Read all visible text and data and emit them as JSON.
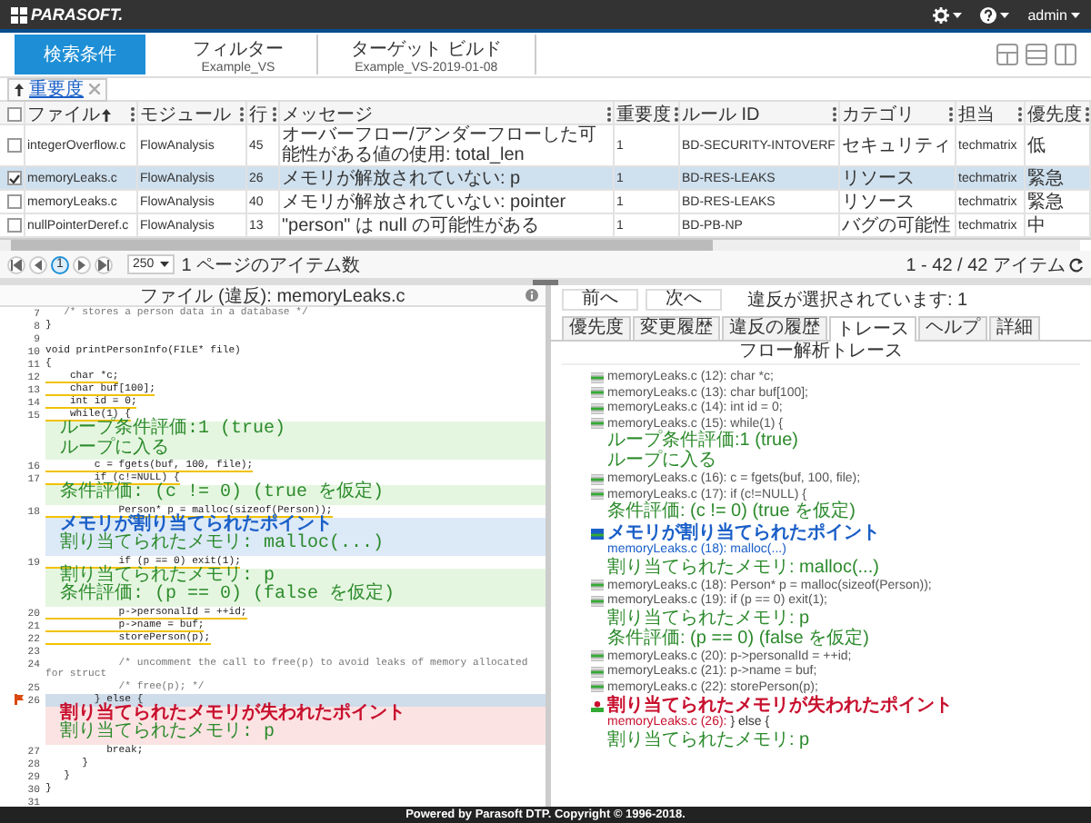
{
  "top_bar": {
    "logo": "PARASOFT.",
    "user": "admin"
  },
  "toolbar": {
    "items": [
      {
        "label": "検索条件",
        "selected": true
      },
      {
        "label": "フィルター",
        "value": "Example_VS",
        "selected": false
      },
      {
        "label": "ターゲット ビルド",
        "value": "Example_VS-2019-01-08",
        "selected": false
      }
    ]
  },
  "sort_chip": {
    "label": "重要度"
  },
  "table": {
    "select_all_checked": false,
    "columns": [
      {
        "label": "ファイル",
        "sorted": true
      },
      {
        "label": "モジュール",
        "sorted": false
      },
      {
        "label": "行",
        "sorted": false
      },
      {
        "label": "メッセージ",
        "sorted": false
      },
      {
        "label": "重要度",
        "sorted": false
      },
      {
        "label": "ルール ID",
        "sorted": false
      },
      {
        "label": "カテゴリ",
        "sorted": false
      },
      {
        "label": "担当",
        "sorted": false
      },
      {
        "label": "優先度",
        "sorted": false
      }
    ],
    "rows": [
      {
        "cells": [
          "integerOverflow.c",
          "FlowAnalysis",
          "45",
          "オーバーフロー/アンダーフローした可能性がある値の使用: total_len",
          "1",
          "BD-SECURITY-INTOVERF",
          "セキュリティ",
          "techmatrix",
          "低"
        ],
        "checked": false,
        "selected": false
      },
      {
        "cells": [
          "memoryLeaks.c",
          "FlowAnalysis",
          "26",
          "メモリが解放されていない: p",
          "1",
          "BD-RES-LEAKS",
          "リソース",
          "techmatrix",
          "緊急"
        ],
        "checked": true,
        "selected": true
      },
      {
        "cells": [
          "memoryLeaks.c",
          "FlowAnalysis",
          "40",
          "メモリが解放されていない: pointer",
          "1",
          "BD-RES-LEAKS",
          "リソース",
          "techmatrix",
          "緊急"
        ],
        "checked": false,
        "selected": false
      },
      {
        "cells": [
          "nullPointerDeref.c",
          "FlowAnalysis",
          "13",
          "\"person\" は null の可能性がある",
          "1",
          "BD-PB-NP",
          "バグの可能性",
          "techmatrix",
          "中"
        ],
        "checked": false,
        "selected": false
      }
    ]
  },
  "pagination": {
    "page": "1",
    "page_size": "250",
    "page_size_label": "1 ページのアイテム数",
    "range": "1 - 42 / 42 アイテム"
  },
  "source_panel": {
    "title": "ファイル (違反): memoryLeaks.c",
    "lines": [
      {
        "kind": "comment",
        "num": "7",
        "text": "   /* stores a person data in a database */",
        "traced": false,
        "selected": false
      },
      {
        "kind": "code",
        "num": "8",
        "text": "}",
        "traced": false,
        "selected": false
      },
      {
        "kind": "code",
        "num": "9",
        "traced": false,
        "selected": false
      },
      {
        "kind": "code",
        "num": "10",
        "text": "void printPersonInfo(FILE* file)",
        "traced": false,
        "selected": false
      },
      {
        "kind": "code",
        "num": "11",
        "text": "{",
        "traced": false,
        "selected": false
      },
      {
        "kind": "code",
        "num": "12",
        "text": "    char *c;",
        "traced": true,
        "selected": false
      },
      {
        "kind": "code",
        "num": "13",
        "text": "    char buf[100];",
        "traced": true,
        "selected": false
      },
      {
        "kind": "code",
        "num": "14",
        "text": "    int id = 0;",
        "traced": true,
        "selected": false
      },
      {
        "kind": "code",
        "num": "15",
        "text": "    while(1) {",
        "traced": true,
        "selected": false
      },
      {
        "kind": "branch",
        "lines": [
          {
            "kind": "value",
            "text": "ループ条件評価:1 (true)"
          },
          {
            "kind": "value",
            "text": "ループに入る"
          }
        ]
      },
      {
        "kind": "code",
        "num": "16",
        "text": "        c = fgets(buf, 100, file);",
        "traced": true,
        "selected": false
      },
      {
        "kind": "code",
        "num": "17",
        "text": "        if (c!=NULL) {",
        "traced": true,
        "selected": false
      },
      {
        "kind": "branch",
        "lines": [
          {
            "kind": "value",
            "text": "条件評価: (c != 0) (true を仮定)"
          }
        ]
      },
      {
        "kind": "code",
        "num": "18",
        "text": "            Person* p = malloc(sizeof(Person));",
        "traced": true,
        "selected": false
      },
      {
        "kind": "alloc",
        "lines": [
          {
            "kind": "event",
            "text": "メモリが割り当てられたポイント"
          },
          {
            "kind": "value",
            "text": "割り当てられたメモリ: malloc(...)"
          }
        ]
      },
      {
        "kind": "code",
        "num": "19",
        "text": "            if (p == 0) exit(1);",
        "traced": true,
        "selected": false
      },
      {
        "kind": "branch",
        "lines": [
          {
            "kind": "value",
            "text": "割り当てられたメモリ: p"
          },
          {
            "kind": "value",
            "text": "条件評価: (p == 0) (false を仮定)"
          }
        ]
      },
      {
        "kind": "code",
        "num": "20",
        "text": "            p->personalId = ++id;",
        "traced": true,
        "selected": false
      },
      {
        "kind": "code",
        "num": "21",
        "text": "            p->name = buf;",
        "traced": true,
        "selected": false
      },
      {
        "kind": "code",
        "num": "22",
        "text": "            storePerson(p);",
        "traced": true,
        "selected": false
      },
      {
        "kind": "code",
        "num": "23",
        "traced": false,
        "selected": false
      },
      {
        "kind": "comment",
        "num": "24",
        "text": "            /* uncomment the call to free(p) to avoid leaks of memory allocated for struct",
        "traced": false,
        "selected": false
      },
      {
        "kind": "comment",
        "num": "25",
        "text": "            /* free(p); */",
        "traced": false,
        "selected": false
      },
      {
        "kind": "code",
        "num": "26",
        "text": "        } else {",
        "traced": false,
        "selected": true
      },
      {
        "kind": "leak",
        "lines": [
          {
            "kind": "event",
            "text": "割り当てられたメモリが失われたポイント"
          },
          {
            "kind": "value",
            "text": "割り当てられたメモリ: p"
          }
        ]
      },
      {
        "kind": "code",
        "num": "27",
        "text": "          break;",
        "traced": false,
        "selected": false
      },
      {
        "kind": "code",
        "num": "28",
        "text": "      }",
        "traced": false,
        "selected": false
      },
      {
        "kind": "code",
        "num": "29",
        "text": "   }",
        "traced": false,
        "selected": false
      },
      {
        "kind": "code",
        "num": "30",
        "text": "}",
        "traced": false,
        "selected": false
      },
      {
        "kind": "code",
        "num": "31",
        "traced": false,
        "selected": false
      }
    ]
  },
  "violation_panel": {
    "buttons": [
      "前へ",
      "次へ"
    ],
    "status": "違反が選択されています: 1",
    "tabs": [
      {
        "label": "優先度",
        "selected": false
      },
      {
        "label": "変更履歴",
        "selected": false
      },
      {
        "label": "違反の履歴",
        "selected": false
      },
      {
        "label": "トレース",
        "selected": true
      },
      {
        "label": "ヘルプ",
        "selected": false
      },
      {
        "label": "詳細",
        "selected": false
      }
    ],
    "trace_title": "フロー解析トレース",
    "trace": [
      {
        "kind": "step",
        "text": "memoryLeaks.c (12): char *c;"
      },
      {
        "kind": "step",
        "text": "memoryLeaks.c (13): char buf[100];"
      },
      {
        "kind": "step",
        "text": "memoryLeaks.c (14): int id = 0;"
      },
      {
        "kind": "step",
        "text": "memoryLeaks.c (15): while(1) {",
        "details": [
          "ループ条件評価:1 (true)",
          "ループに入る"
        ]
      },
      {
        "kind": "step",
        "text": "memoryLeaks.c (16): c = fgets(buf, 100, file);"
      },
      {
        "kind": "step",
        "text": "memoryLeaks.c (17): if (c!=NULL) {",
        "details": [
          "条件評価: (c != 0) (true を仮定)"
        ]
      },
      {
        "kind": "alloc",
        "text": "メモリが割り当てられたポイント",
        "location": "memoryLeaks.c (18): malloc(...)",
        "details": [
          "割り当てられたメモリ: malloc(...)"
        ]
      },
      {
        "kind": "step",
        "text": "memoryLeaks.c (18): Person* p = malloc(sizeof(Person));"
      },
      {
        "kind": "step",
        "text": "memoryLeaks.c (19): if (p == 0) exit(1);",
        "details": [
          "割り当てられたメモリ: p",
          "条件評価: (p == 0) (false を仮定)"
        ]
      },
      {
        "kind": "step",
        "text": "memoryLeaks.c (20): p->personalId = ++id;"
      },
      {
        "kind": "step",
        "text": "memoryLeaks.c (21): p->name = buf;"
      },
      {
        "kind": "step",
        "text": "memoryLeaks.c (22): storePerson(p);"
      },
      {
        "kind": "leak",
        "text": "割り当てられたメモリが失われたポイント",
        "location": "memoryLeaks.c (26):",
        "code": "} else {",
        "details": [
          "割り当てられたメモリ: p"
        ]
      }
    ]
  },
  "footer": "Powered by Parasoft DTP. Copyright © 1996-2018."
}
